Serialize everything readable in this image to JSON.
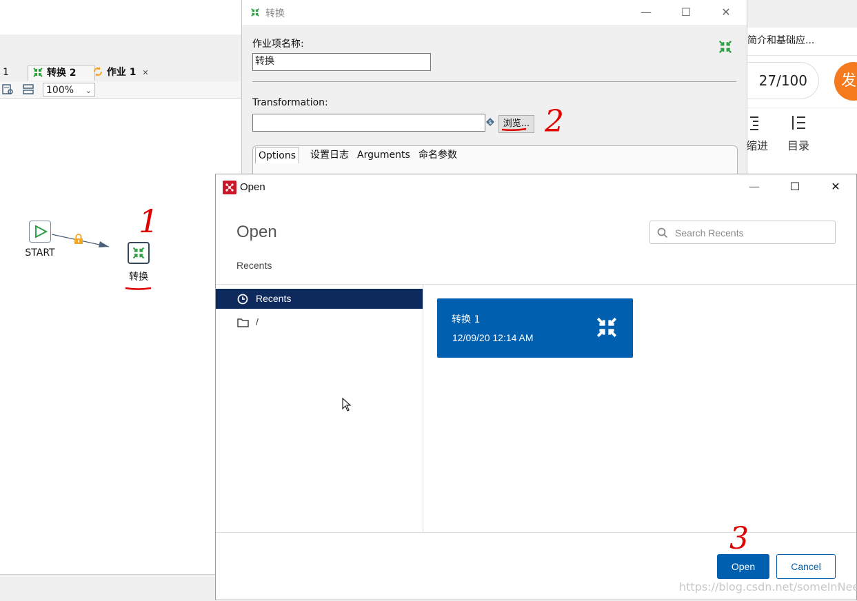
{
  "background": {
    "tabs": [
      {
        "label": "1"
      },
      {
        "label": "转换 2"
      },
      {
        "label": "作业 1"
      }
    ],
    "zoom": "100%",
    "canvas": {
      "start_label": "START",
      "transform_label": "转换"
    },
    "right_page": {
      "link_text": "简介和基础应...",
      "counter": "27/100",
      "orange_char": "发",
      "indent_label": "缩进",
      "toc_label": "目录"
    }
  },
  "job_dialog": {
    "title": "转换",
    "entry_name_label": "作业项名称:",
    "entry_name_value": "转换",
    "transformation_label": "Transformation:",
    "transformation_value": "",
    "browse_label": "浏览...",
    "tabs": [
      "Options",
      "设置日志",
      "Arguments",
      "命名参数"
    ]
  },
  "open_dialog": {
    "window_title": "Open",
    "heading": "Open",
    "subheading": "Recents",
    "search_placeholder": "Search Recents",
    "nav": [
      {
        "label": "Recents",
        "icon": "clock-icon",
        "selected": true
      },
      {
        "label": "/",
        "icon": "folder-icon",
        "selected": false
      }
    ],
    "recent_files": [
      {
        "name": "转换 1",
        "date": "12/09/20 12:14 AM",
        "icon": "transformation-icon"
      }
    ],
    "open_label": "Open",
    "cancel_label": "Cancel"
  },
  "annotations": {
    "mark_1": "1",
    "mark_2": "2",
    "mark_3": "3"
  },
  "watermark": "https://blog.csdn.net/someInNeed",
  "colors": {
    "accent_blue": "#005fae",
    "nav_selected": "#0e2a5c",
    "annotation_red": "#e00000",
    "orange": "#f57a1e",
    "green_icon": "#2ea043"
  }
}
